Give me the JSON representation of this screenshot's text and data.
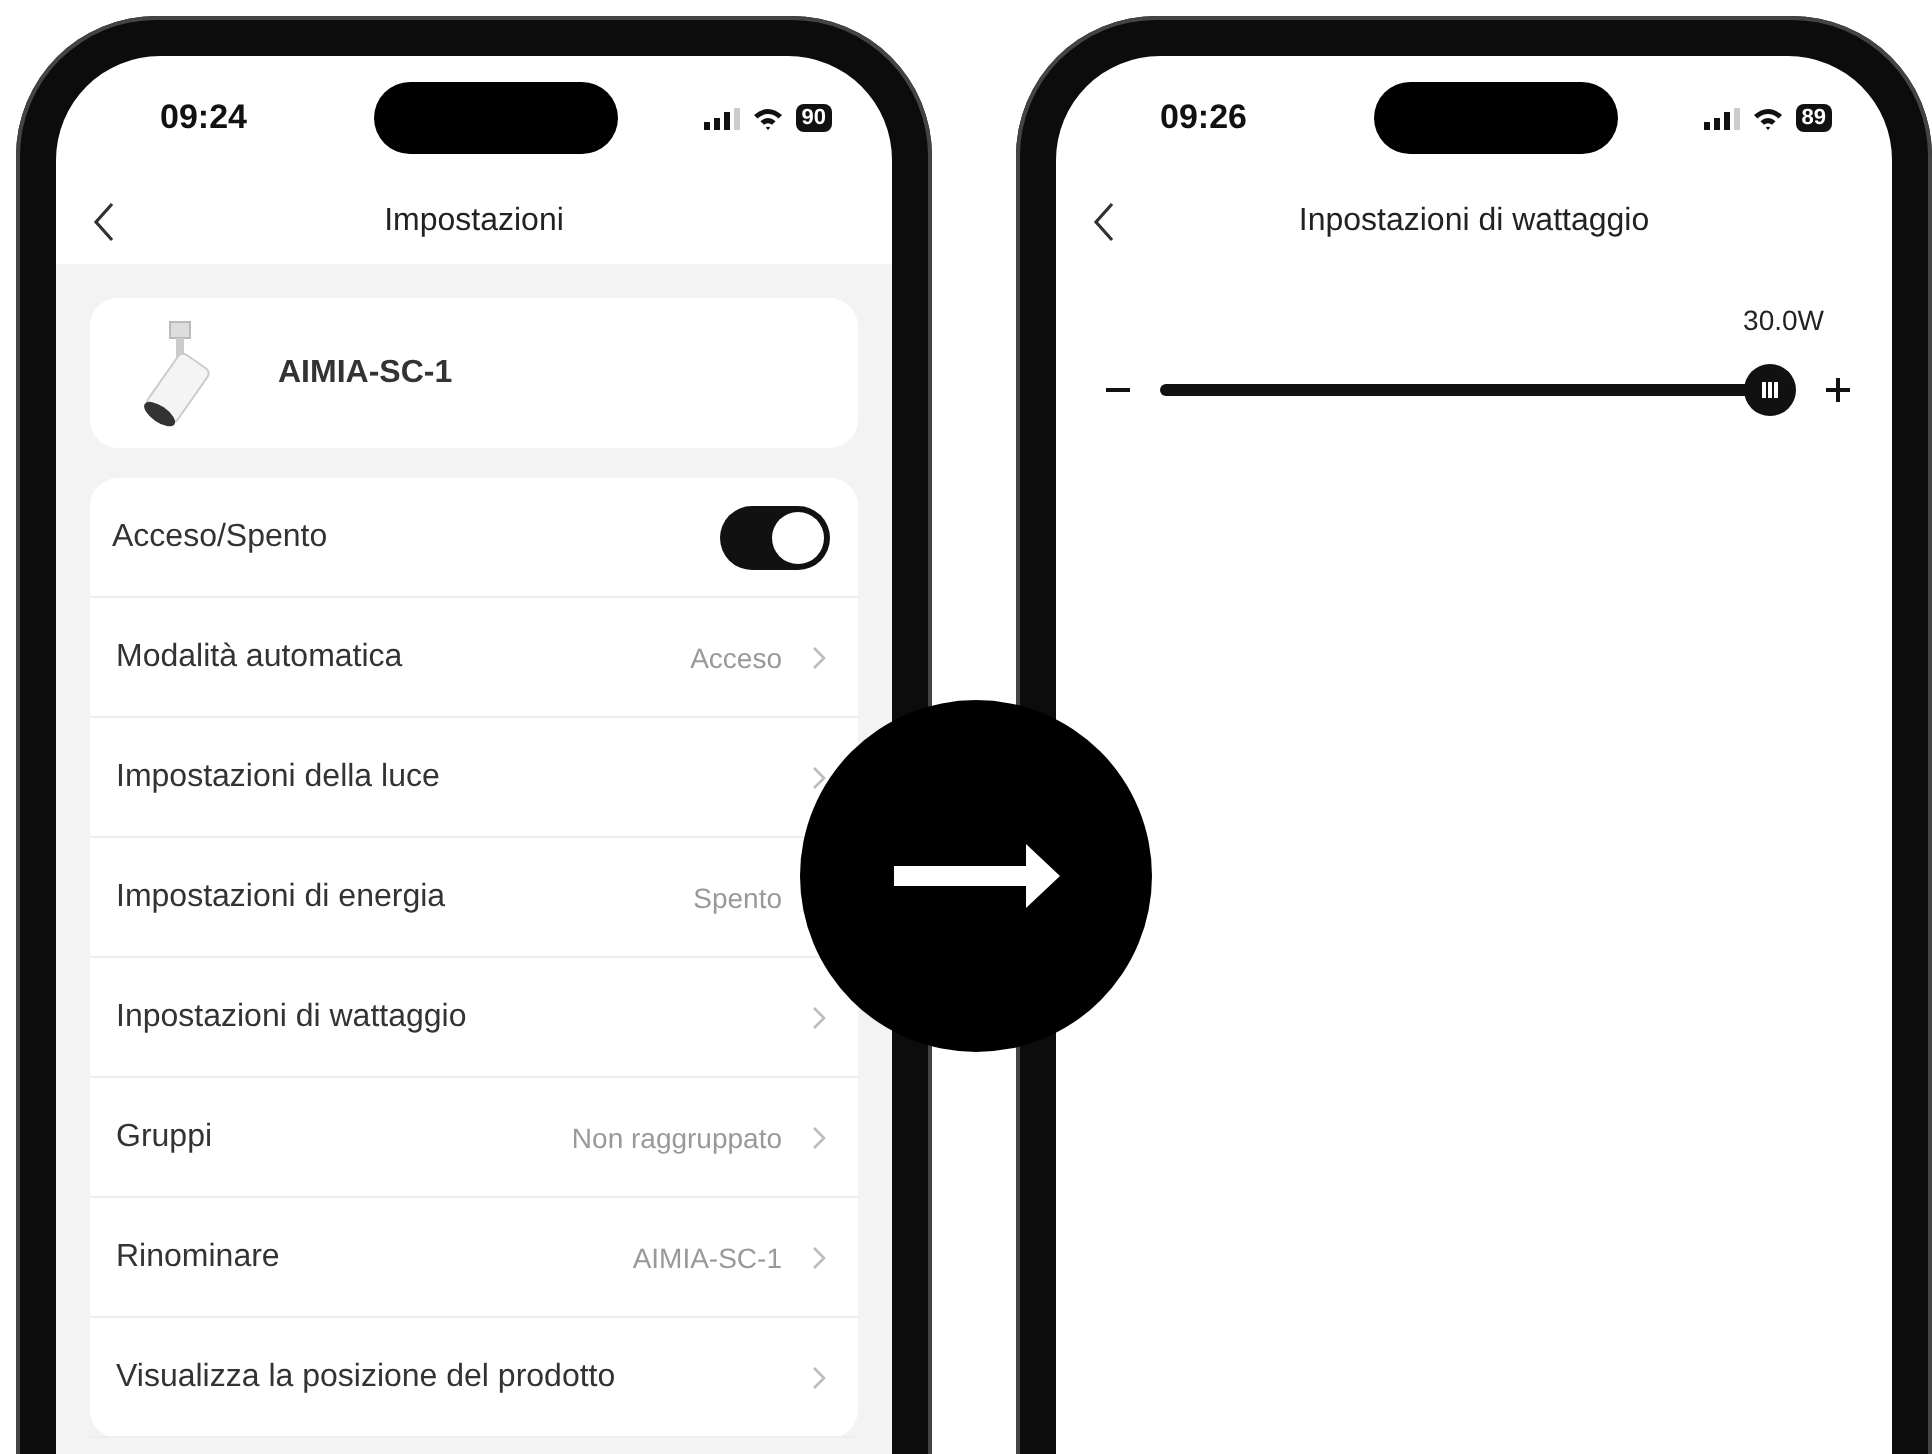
{
  "phones": [
    {
      "kind": "settings",
      "status_bar": {
        "time": "09:24",
        "battery": "90"
      },
      "header": {
        "title": "Impostazioni"
      },
      "device": {
        "name": "AIMIA-SC-1"
      },
      "rows": [
        {
          "kind": "toggle",
          "label": "Acceso/Spento",
          "on": true
        },
        {
          "kind": "link",
          "label": "Modalità automatica",
          "value": "Acceso",
          "chevron": true
        },
        {
          "kind": "link",
          "label": "Impostazioni della luce",
          "chevron": true
        },
        {
          "kind": "link",
          "label": "Impostazioni di energia",
          "value": "Spento",
          "chevron": false
        },
        {
          "kind": "link",
          "label": "Inpostazioni di wattaggio",
          "chevron": true
        },
        {
          "kind": "link",
          "label": "Gruppi",
          "value": "Non raggruppato",
          "chevron": true
        },
        {
          "kind": "link",
          "label": "Rinominare",
          "value": "AIMIA-SC-1",
          "chevron": true
        },
        {
          "kind": "link",
          "label": "Visualizza la posizione del prodotto",
          "chevron": true
        }
      ]
    },
    {
      "kind": "wattage",
      "status_bar": {
        "time": "09:26",
        "battery": "89"
      },
      "header": {
        "title": "Inpostazioni di wattaggio"
      },
      "slider": {
        "reading": "30.0W",
        "level": 1
      }
    }
  ]
}
